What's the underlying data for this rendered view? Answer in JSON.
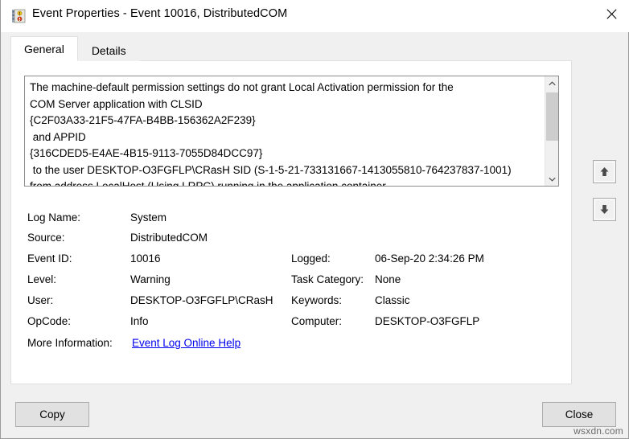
{
  "window": {
    "title": "Event Properties - Event 10016, DistributedCOM",
    "icon": "event-properties-icon",
    "close_label": "✕"
  },
  "tabs": [
    {
      "label": "General",
      "active": true
    },
    {
      "label": "Details",
      "active": false
    }
  ],
  "description": {
    "text": "The machine-default permission settings do not grant Local Activation permission for the\nCOM Server application with CLSID\n{C2F03A33-21F5-47FA-B4BB-156362A2F239}\n and APPID\n{316CDED5-E4AE-4B15-9113-7055D84DCC97}\n to the user DESKTOP-O3FGFLP\\CRasH SID (S-1-5-21-733131667-1413055810-764237837-1001)\nfrom address LocalHost (Using LRPC) running in the application container",
    "scroll_up_glyph": "⌃",
    "scroll_down_glyph": "⌄"
  },
  "fields_left": [
    {
      "label": "Log Name:",
      "value": "System"
    },
    {
      "label": "Source:",
      "value": "DistributedCOM"
    },
    {
      "label": "Event ID:",
      "value": "10016"
    },
    {
      "label": "Level:",
      "value": "Warning"
    },
    {
      "label": "User:",
      "value": "DESKTOP-O3FGFLP\\CRasH"
    },
    {
      "label": "OpCode:",
      "value": "Info"
    }
  ],
  "fields_right": [
    {
      "label": "Logged:",
      "value": "06-Sep-20 2:34:26 PM"
    },
    {
      "label": "Task Category:",
      "value": "None"
    },
    {
      "label": "Keywords:",
      "value": "Classic"
    },
    {
      "label": "Computer:",
      "value": "DESKTOP-O3FGFLP"
    }
  ],
  "more_information": {
    "label": "More Information:",
    "link_text": "Event Log Online Help",
    "link_color": "#0000ee"
  },
  "nav_buttons": {
    "up": "previous-event-arrow",
    "down": "next-event-arrow"
  },
  "buttons": {
    "copy": "Copy",
    "close": "Close"
  },
  "watermark": "wsxdn.com"
}
